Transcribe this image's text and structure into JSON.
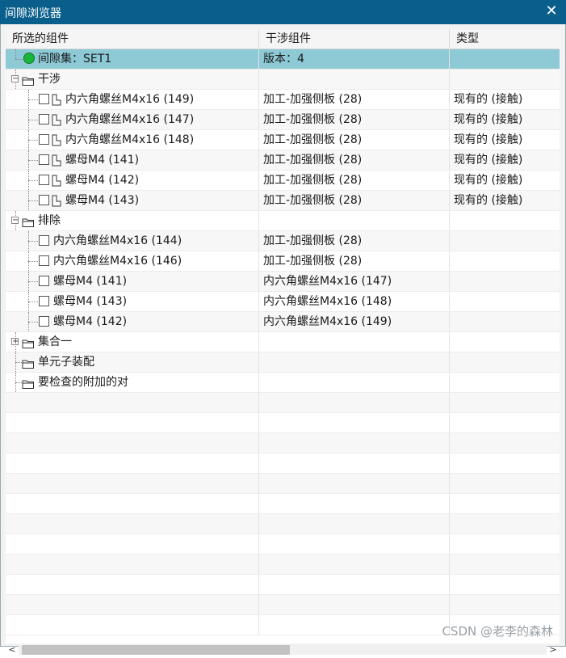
{
  "window": {
    "title": "间隙浏览器",
    "close_symbol": "✕"
  },
  "columns": {
    "selected_components": "所选的组件",
    "interfering_components": "干涉组件",
    "type": "类型"
  },
  "rows": [
    {
      "label": "间隙集：SET1",
      "col2": "版本：4",
      "col3": ""
    },
    {
      "label": "干涉",
      "col2": "",
      "col3": ""
    },
    {
      "label": "内六角螺丝M4x16 (149)",
      "col2": "加工-加强侧板 (28)",
      "col3": "现有的 (接触)"
    },
    {
      "label": "内六角螺丝M4x16 (147)",
      "col2": "加工-加强侧板 (28)",
      "col3": "现有的 (接触)"
    },
    {
      "label": "内六角螺丝M4x16 (148)",
      "col2": "加工-加强侧板 (28)",
      "col3": "现有的 (接触)"
    },
    {
      "label": "螺母M4 (141)",
      "col2": "加工-加强侧板 (28)",
      "col3": "现有的 (接触)"
    },
    {
      "label": "螺母M4 (142)",
      "col2": "加工-加强侧板 (28)",
      "col3": "现有的 (接触)"
    },
    {
      "label": "螺母M4 (143)",
      "col2": "加工-加强侧板 (28)",
      "col3": "现有的 (接触)"
    },
    {
      "label": "排除",
      "col2": "",
      "col3": ""
    },
    {
      "label": "内六角螺丝M4x16 (144)",
      "col2": "加工-加强侧板 (28)",
      "col3": ""
    },
    {
      "label": "内六角螺丝M4x16 (146)",
      "col2": "加工-加强侧板 (28)",
      "col3": ""
    },
    {
      "label": "螺母M4 (141)",
      "col2": "内六角螺丝M4x16 (147)",
      "col3": ""
    },
    {
      "label": "螺母M4 (143)",
      "col2": "内六角螺丝M4x16 (148)",
      "col3": ""
    },
    {
      "label": "螺母M4 (142)",
      "col2": "内六角螺丝M4x16 (149)",
      "col3": ""
    },
    {
      "label": "集合一",
      "col2": "",
      "col3": ""
    },
    {
      "label": "单元子装配",
      "col2": "",
      "col3": ""
    },
    {
      "label": "要检查的附加的对",
      "col2": "",
      "col3": ""
    }
  ],
  "scrollbar": {
    "left_arrow": "<",
    "right_arrow": ">"
  },
  "watermark": "CSDN @老李的森林",
  "colors": {
    "titlebar": "#0a5e8c",
    "selected_row": "#8ec9d6",
    "status_dot": "#19b53b"
  }
}
